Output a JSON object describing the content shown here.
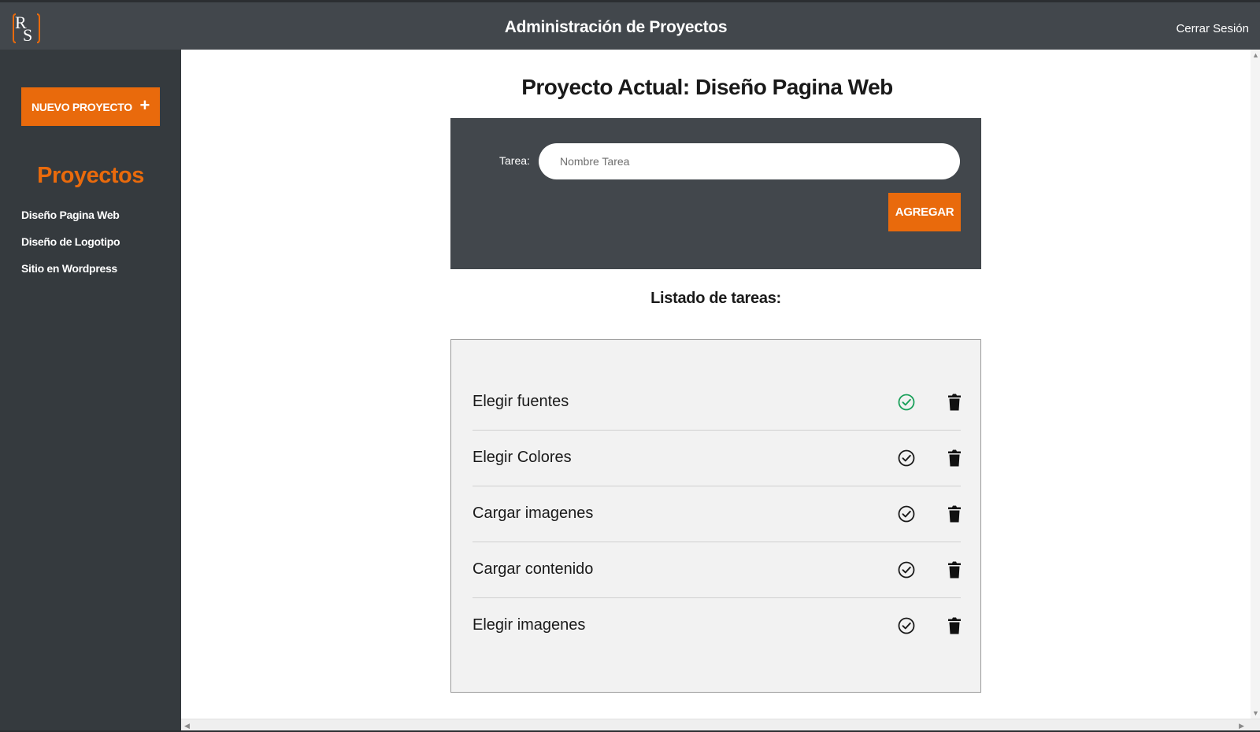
{
  "header": {
    "logo_text": "RS",
    "title": "Administración de Proyectos",
    "logout_label": "Cerrar Sesión"
  },
  "sidebar": {
    "new_project_label": "NUEVO PROYECTO",
    "new_project_icon": "+",
    "heading": "Proyectos",
    "projects": [
      {
        "label": "Diseño Pagina Web"
      },
      {
        "label": "Diseño de Logotipo"
      },
      {
        "label": "Sitio en Wordpress"
      }
    ]
  },
  "main": {
    "current_label": "Proyecto Actual:",
    "current_project": "Diseño Pagina Web",
    "form": {
      "task_label": "Tarea:",
      "task_placeholder": "Nombre Tarea",
      "task_value": "",
      "add_label": "AGREGAR"
    },
    "list_title": "Listado de tareas:",
    "tasks": [
      {
        "name": "Elegir fuentes",
        "completed": true
      },
      {
        "name": "Elegir Colores",
        "completed": false
      },
      {
        "name": "Cargar imagenes",
        "completed": false
      },
      {
        "name": "Cargar contenido",
        "completed": false
      },
      {
        "name": "Elegir imagenes",
        "completed": false
      }
    ]
  },
  "colors": {
    "accent": "#e96a0c",
    "header_bg": "#42474c",
    "sidebar_bg": "#353a3e",
    "task_panel_bg": "#f2f2f2",
    "completed_green": "#1aa05a",
    "pending_dark": "#1a1a1a"
  }
}
